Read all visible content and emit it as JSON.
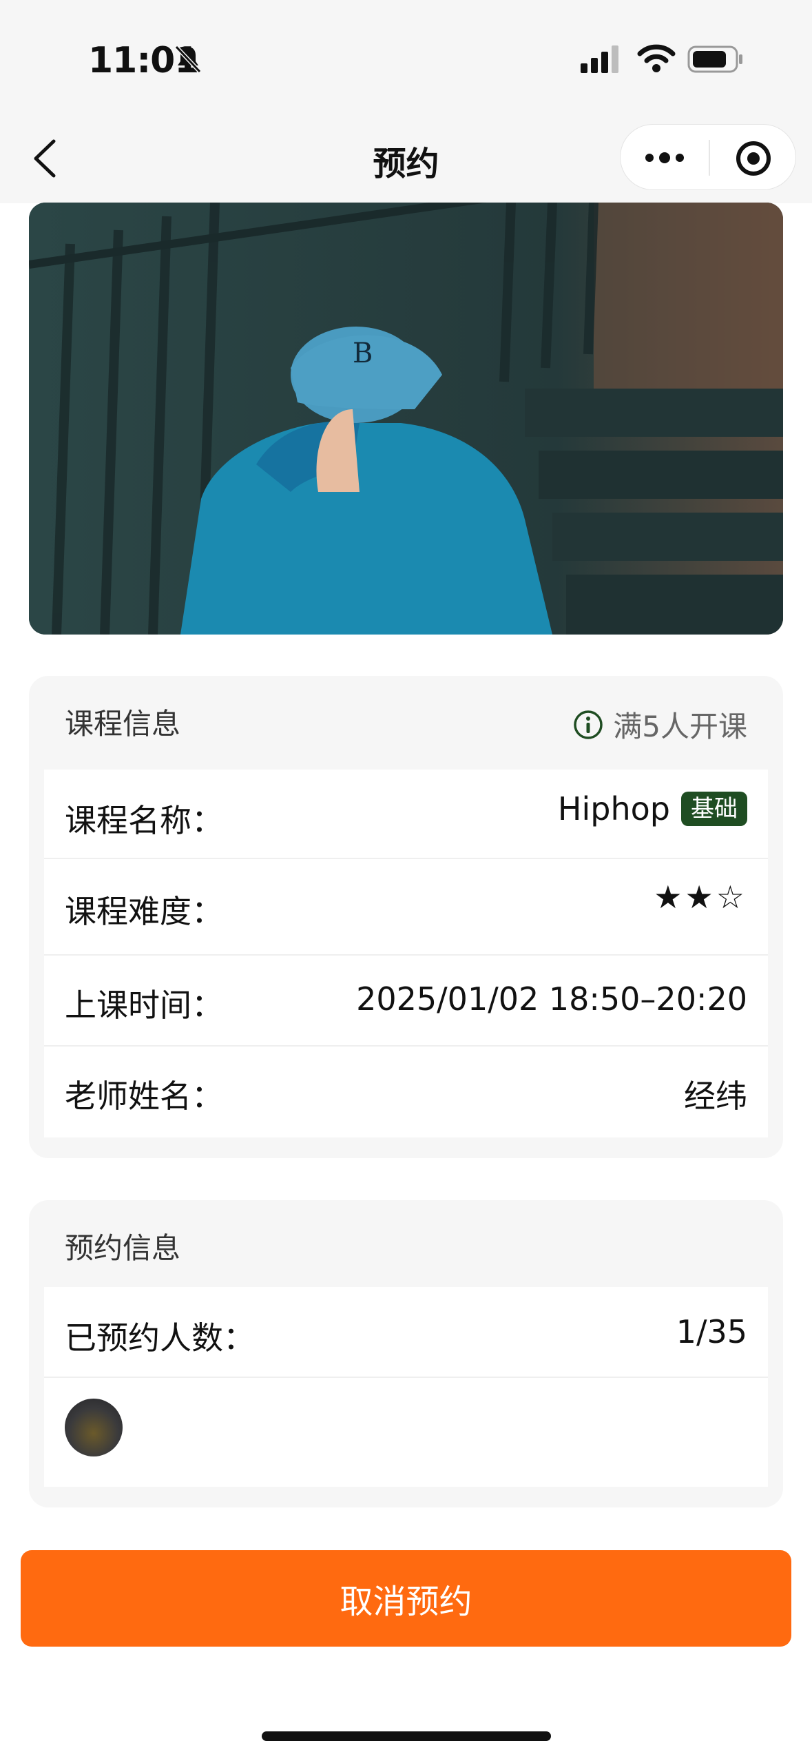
{
  "status_bar": {
    "time": "11:01"
  },
  "nav": {
    "title": "预约"
  },
  "course_card": {
    "header": "课程信息",
    "badge": "满5人开课",
    "rows": [
      {
        "label": "课程名称：",
        "value": "Hiphop",
        "tag": "基础"
      },
      {
        "label": "课程难度：",
        "stars": "★★☆",
        "rating": 2,
        "rating_max": 3
      },
      {
        "label": "上课时间：",
        "value": "2025/01/02 18:50–20:20"
      },
      {
        "label": "老师姓名：",
        "value": "经纬"
      }
    ]
  },
  "booking_card": {
    "header": "预约信息",
    "rows": [
      {
        "label": "已预约人数：",
        "value": "1/35"
      }
    ]
  },
  "actions": {
    "cancel_label": "取消预约"
  },
  "colors": {
    "accent_orange": "#ff6a10",
    "tag_green": "#1f4d22"
  }
}
